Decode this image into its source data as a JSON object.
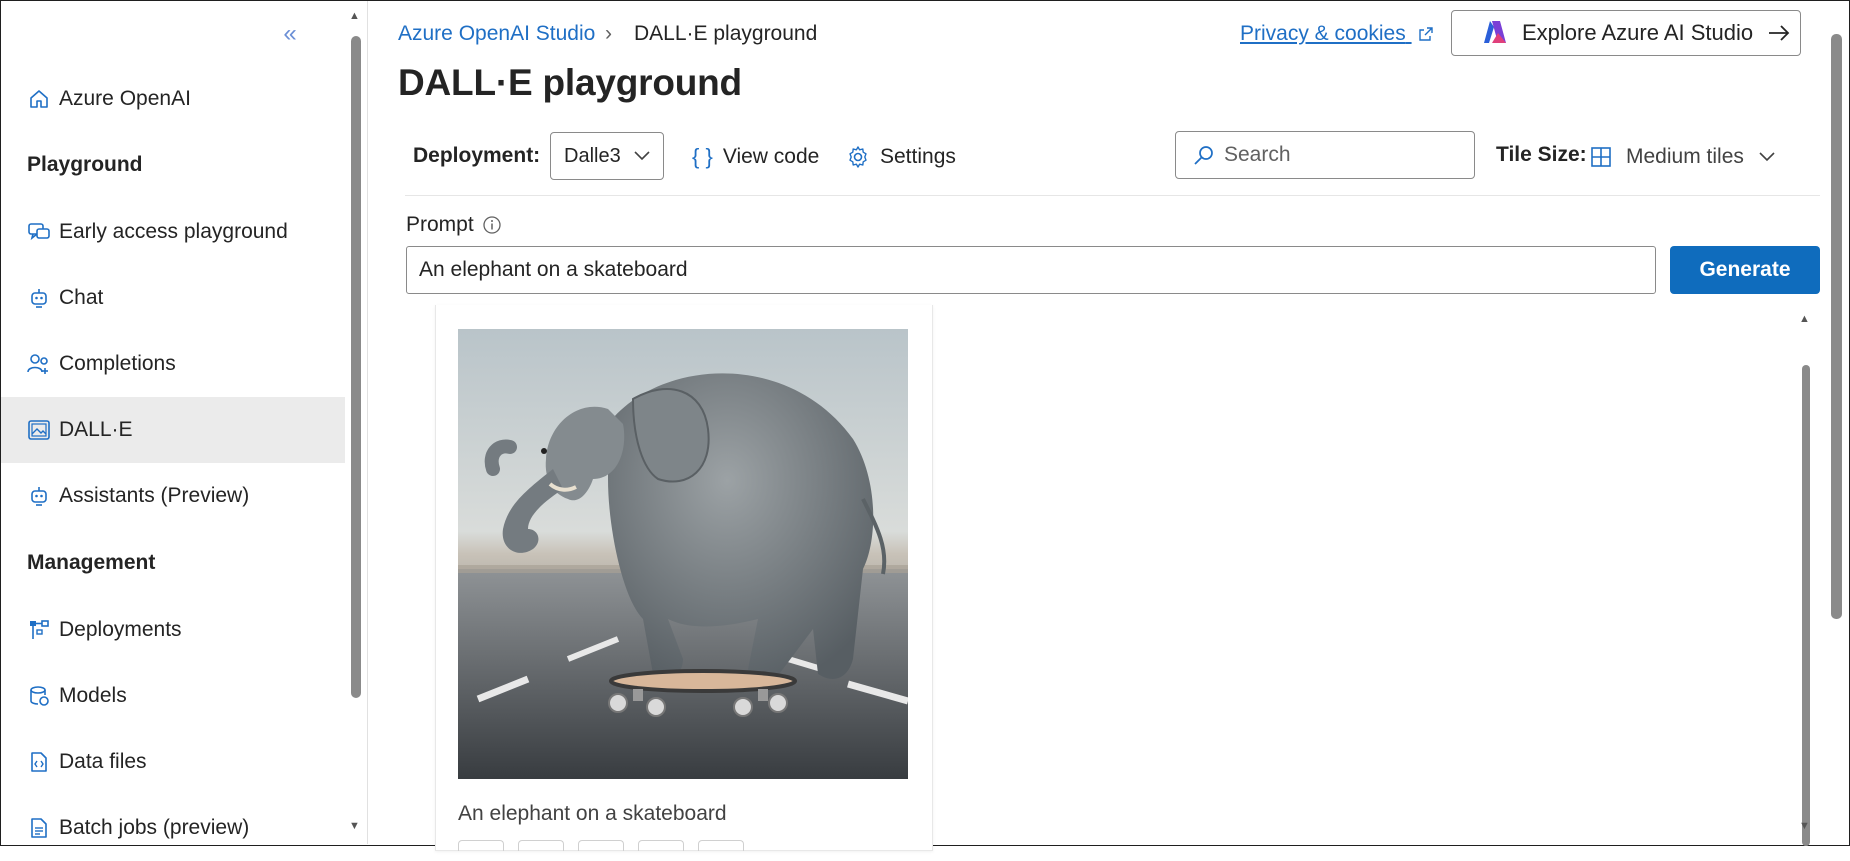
{
  "sidebar": {
    "collapse_glyph": "«",
    "top_item": "Azure OpenAI",
    "section_playground": "Playground",
    "section_management": "Management",
    "items": [
      {
        "label": "Early access playground",
        "icon": "chat-multiple-icon"
      },
      {
        "label": "Chat",
        "icon": "bot-icon"
      },
      {
        "label": "Completions",
        "icon": "people-icon"
      },
      {
        "label": "DALL·E",
        "icon": "image-icon",
        "selected": true
      },
      {
        "label": "Assistants (Preview)",
        "icon": "bot-icon"
      },
      {
        "label": "Deployments",
        "icon": "deployments-icon"
      },
      {
        "label": "Models",
        "icon": "database-icon"
      },
      {
        "label": "Data files",
        "icon": "document-code-icon"
      },
      {
        "label": "Batch jobs (preview)",
        "icon": "document-list-icon"
      }
    ]
  },
  "breadcrumb": {
    "root": "Azure OpenAI Studio",
    "current": "DALL·E playground"
  },
  "header": {
    "title": "DALL·E playground",
    "privacy_link": "Privacy & cookies",
    "explore_button": "Explore Azure AI Studio"
  },
  "toolbar": {
    "deployment_label": "Deployment:",
    "deployment_value": "Dalle3",
    "view_code": "View code",
    "settings": "Settings",
    "search_placeholder": "Search",
    "tile_size_label": "Tile Size:",
    "tile_size_value": "Medium tiles"
  },
  "prompt": {
    "label": "Prompt",
    "value": "An elephant on a skateboard",
    "generate_button": "Generate"
  },
  "gallery": {
    "items": [
      {
        "caption": "An elephant on a skateboard"
      }
    ]
  },
  "colors": {
    "accent": "#0f6cbd",
    "link": "#1f6fc5",
    "selected_bg": "#ebebeb"
  }
}
